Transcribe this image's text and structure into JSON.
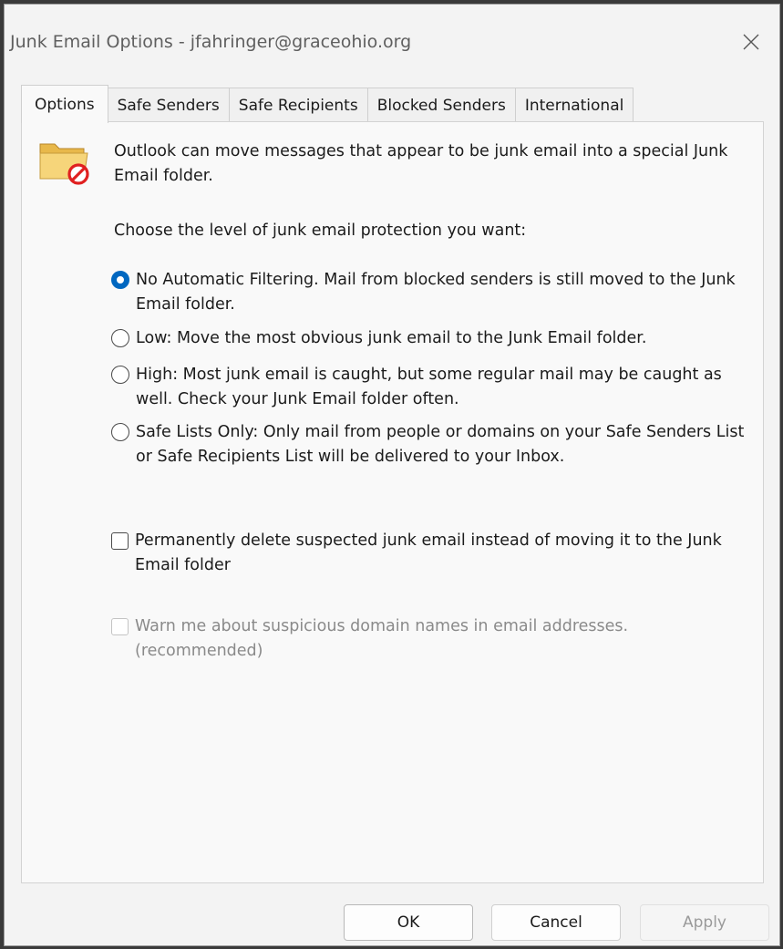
{
  "window": {
    "title": "Junk Email Options - jfahringer@graceohio.org",
    "close_glyph": "✕"
  },
  "tabs": [
    {
      "label": "Options",
      "active": true
    },
    {
      "label": "Safe Senders",
      "active": false
    },
    {
      "label": "Safe Recipients",
      "active": false
    },
    {
      "label": "Blocked Senders",
      "active": false
    },
    {
      "label": "International",
      "active": false
    }
  ],
  "options_panel": {
    "icon": "junk-folder-icon",
    "intro": "Outlook can move messages that appear to be junk email into a special Junk Email folder.",
    "choose_label": "Choose the level of junk email protection you want:",
    "levels": [
      {
        "label": "No Automatic Filtering. Mail from blocked senders is still moved to the Junk Email folder.",
        "selected": true
      },
      {
        "label": "Low: Move the most obvious junk email to the Junk Email folder.",
        "selected": false
      },
      {
        "label": "High: Most junk email is caught, but some regular mail may be caught as well. Check your Junk Email folder often.",
        "selected": false
      },
      {
        "label": "Safe Lists Only: Only mail from people or domains on your Safe Senders List or Safe Recipients List will be delivered to your Inbox.",
        "selected": false
      }
    ],
    "permanently_delete": {
      "label": "Permanently delete suspected junk email instead of moving it to the Junk Email folder",
      "checked": false
    },
    "warn_suspicious": {
      "label": "Warn me about suspicious domain names in email addresses. (recommended)",
      "checked": false,
      "enabled": false
    }
  },
  "buttons": {
    "ok": "OK",
    "cancel": "Cancel",
    "apply": "Apply"
  },
  "colors": {
    "accent": "#0067c0",
    "no_symbol": "#e02020"
  }
}
